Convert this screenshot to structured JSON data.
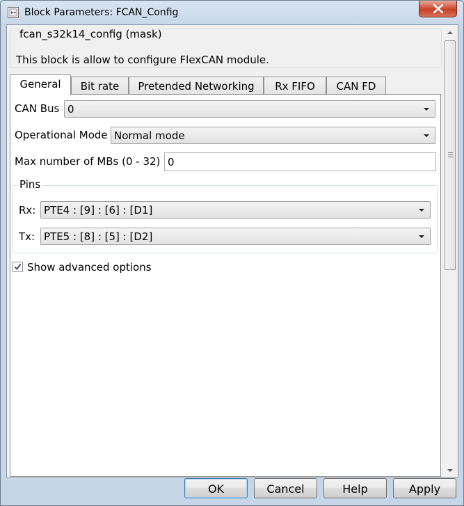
{
  "window": {
    "title": "Block Parameters: FCAN_Config",
    "icon": "simulink-block-icon",
    "close_icon": "close-icon"
  },
  "description": {
    "title": "fcan_s32k14_config (mask)",
    "text": "This block is allow to configure FlexCAN module."
  },
  "tabs": [
    {
      "label": "General",
      "active": true
    },
    {
      "label": "Bit rate",
      "active": false
    },
    {
      "label": "Pretended Networking",
      "active": false
    },
    {
      "label": "Rx FIFO",
      "active": false
    },
    {
      "label": "CAN FD",
      "active": false
    }
  ],
  "general": {
    "can_bus_label": "CAN Bus",
    "can_bus_value": "0",
    "op_mode_label": "Operational Mode",
    "op_mode_value": "Normal mode",
    "max_mbs_label": "Max number of MBs (0 - 32)",
    "max_mbs_value": "0",
    "pins": {
      "title": "Pins",
      "rx_label": "Rx:",
      "rx_value": "PTE4 : [9] : [6] : [D1]",
      "tx_label": "Tx:",
      "tx_value": "PTE5 : [8] : [5] : [D2]"
    },
    "show_advanced_label": "Show advanced options",
    "show_advanced_checked": true
  },
  "buttons": {
    "ok": "OK",
    "cancel": "Cancel",
    "help": "Help",
    "apply": "Apply"
  }
}
